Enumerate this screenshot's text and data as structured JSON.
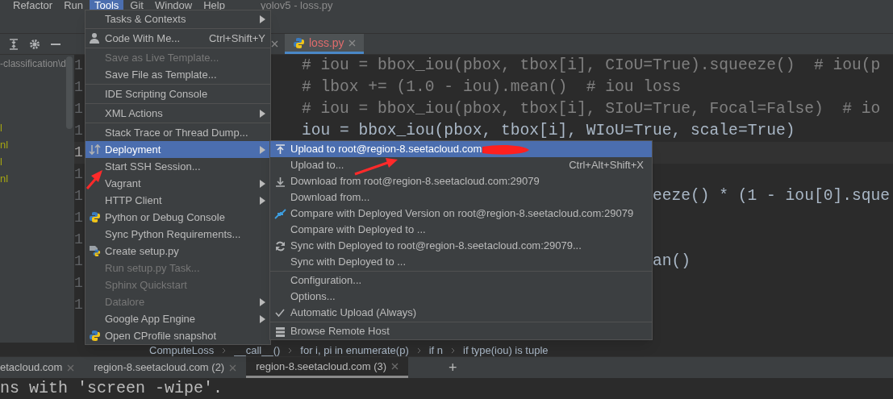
{
  "menu_bar": [
    {
      "label": "Refactor",
      "selected": false
    },
    {
      "label": "Run",
      "selected": false
    },
    {
      "label": "Tools",
      "selected": true
    },
    {
      "label": "Git",
      "selected": false
    },
    {
      "label": "Window",
      "selected": false
    },
    {
      "label": "Help",
      "selected": false
    }
  ],
  "window_title": "yolov5 - loss.py",
  "project_panel": {
    "path": "-classification\\d",
    "files": [
      "l",
      "nl",
      "l",
      "nl"
    ]
  },
  "editor_tabs": [
    {
      "label": "loss.py",
      "selected": true
    }
  ],
  "code_lines": [
    {
      "number": "1",
      "text": "# iou = bbox_iou(pbox, tbox[i], CIoU=True).squeeze()  # iou(p",
      "kind": "comment",
      "current": false
    },
    {
      "number": "1",
      "text": "# lbox += (1.0 - iou).mean()  # iou loss",
      "kind": "comment",
      "current": false
    },
    {
      "number": "1",
      "text": "# iou = bbox_iou(pbox, tbox[i], SIoU=True, Focal=False)  # io",
      "kind": "comment",
      "current": false
    },
    {
      "number": "1",
      "text": "iou = bbox_iou(pbox, tbox[i], WIoU=True, scale=True)",
      "kind": "code",
      "current": false
    },
    {
      "number": "1",
      "kind": "code",
      "current": true
    },
    {
      "number": "1",
      "kind": "code",
      "current": false
    },
    {
      "number": "1",
      "text": "eeze() * (1 - iou[0].sque",
      "kind": "partial",
      "current": false
    },
    {
      "number": "1",
      "kind": "code",
      "current": false
    },
    {
      "number": "1",
      "kind": "code",
      "current": false
    },
    {
      "number": "1",
      "text": "an()",
      "kind": "partial",
      "current": false
    },
    {
      "number": "1",
      "kind": "code",
      "current": false
    },
    {
      "number": "1",
      "kind": "code",
      "current": false
    }
  ],
  "breadcrumb": [
    "ComputeLoss",
    "__call__()",
    "for i, pi in enumerate(p)",
    "if n",
    "if type(iou) is tuple"
  ],
  "tools_menu": [
    {
      "kind": "item",
      "label": "Tasks & Contexts",
      "submenu": true,
      "disabled": false,
      "selected": false
    },
    {
      "kind": "separator"
    },
    {
      "kind": "item",
      "label": "Code With Me...",
      "shortcut": "Ctrl+Shift+Y",
      "submenu": false,
      "disabled": false,
      "selected": false
    },
    {
      "kind": "separator"
    },
    {
      "kind": "item",
      "label": "Save as Live Template...",
      "submenu": false,
      "disabled": true,
      "selected": false
    },
    {
      "kind": "item",
      "label": "Save File as Template...",
      "submenu": false,
      "disabled": false,
      "selected": false
    },
    {
      "kind": "separator"
    },
    {
      "kind": "item",
      "label": "IDE Scripting Console",
      "submenu": false,
      "disabled": false,
      "selected": false
    },
    {
      "kind": "separator"
    },
    {
      "kind": "item",
      "label": "XML Actions",
      "submenu": true,
      "disabled": false,
      "selected": false
    },
    {
      "kind": "separator"
    },
    {
      "kind": "item",
      "label": "Stack Trace or Thread Dump...",
      "submenu": false,
      "disabled": false,
      "selected": false
    },
    {
      "kind": "item",
      "label": "Deployment",
      "submenu": true,
      "disabled": false,
      "selected": true
    },
    {
      "kind": "item",
      "label": "Start SSH Session...",
      "submenu": false,
      "disabled": false,
      "selected": false
    },
    {
      "kind": "item",
      "label": "Vagrant",
      "submenu": true,
      "disabled": false,
      "selected": false
    },
    {
      "kind": "item",
      "label": "HTTP Client",
      "submenu": true,
      "disabled": false,
      "selected": false
    },
    {
      "kind": "item",
      "label": "Python or Debug Console",
      "submenu": false,
      "disabled": false,
      "selected": false
    },
    {
      "kind": "item",
      "label": "Sync Python Requirements...",
      "submenu": false,
      "disabled": false,
      "selected": false
    },
    {
      "kind": "item",
      "label": "Create setup.py",
      "submenu": false,
      "disabled": false,
      "selected": false
    },
    {
      "kind": "item",
      "label": "Run setup.py Task...",
      "submenu": false,
      "disabled": true,
      "selected": false
    },
    {
      "kind": "item",
      "label": "Sphinx Quickstart",
      "submenu": false,
      "disabled": true,
      "selected": false
    },
    {
      "kind": "item",
      "label": "Datalore",
      "submenu": true,
      "disabled": true,
      "selected": false
    },
    {
      "kind": "item",
      "label": "Google App Engine",
      "submenu": true,
      "disabled": false,
      "selected": false
    },
    {
      "kind": "item",
      "label": "Open CProfile snapshot",
      "submenu": false,
      "disabled": false,
      "selected": false
    }
  ],
  "deployment_submenu": [
    {
      "kind": "item",
      "label": "Upload to root@region-8.seetacloud.com",
      "selected": true,
      "checked": false
    },
    {
      "kind": "item",
      "label": "Upload to...",
      "shortcut": "Ctrl+Alt+Shift+X",
      "selected": false,
      "checked": false
    },
    {
      "kind": "item",
      "label": "Download from root@region-8.seetacloud.com:29079",
      "selected": false,
      "checked": false
    },
    {
      "kind": "item",
      "label": "Download from...",
      "selected": false,
      "checked": false
    },
    {
      "kind": "item",
      "label": "Compare with Deployed Version on root@region-8.seetacloud.com:29079",
      "selected": false,
      "checked": false
    },
    {
      "kind": "item",
      "label": "Compare with Deployed to ...",
      "selected": false,
      "checked": false
    },
    {
      "kind": "item",
      "label": "Sync with Deployed to root@region-8.seetacloud.com:29079...",
      "selected": false,
      "checked": false
    },
    {
      "kind": "item",
      "label": "Sync with Deployed to ...",
      "selected": false,
      "checked": false
    },
    {
      "kind": "separator"
    },
    {
      "kind": "item",
      "label": "Configuration...",
      "selected": false,
      "checked": false
    },
    {
      "kind": "item",
      "label": "Options...",
      "selected": false,
      "checked": false
    },
    {
      "kind": "item",
      "label": "Automatic Upload (Always)",
      "selected": false,
      "checked": true
    },
    {
      "kind": "separator"
    },
    {
      "kind": "item",
      "label": "Browse Remote Host",
      "selected": false,
      "checked": false
    }
  ],
  "terminal_tabs": [
    {
      "label": "etacloud.com",
      "selected": false
    },
    {
      "label": "region-8.seetacloud.com (2)",
      "selected": false
    },
    {
      "label": "region-8.seetacloud.com (3)",
      "selected": true
    }
  ],
  "terminal_add": "+",
  "terminal_output": "ns with 'screen -wipe'."
}
